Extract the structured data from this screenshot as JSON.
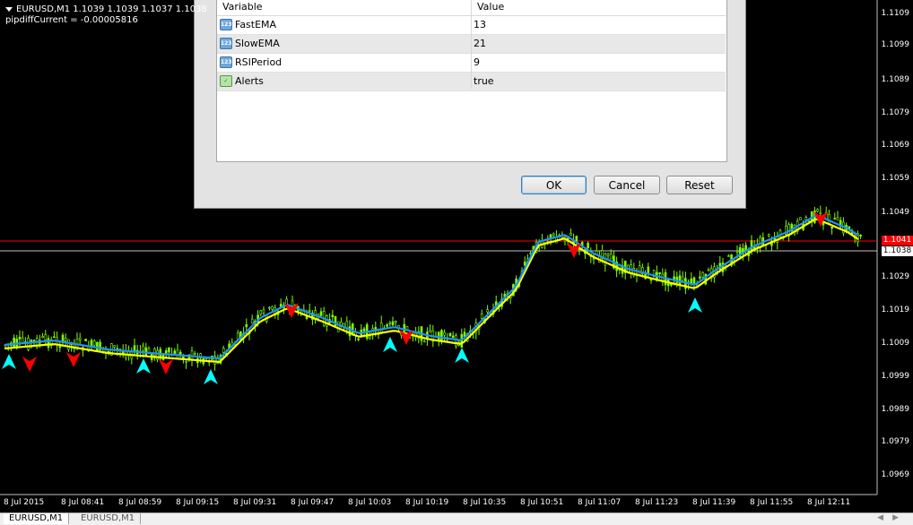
{
  "chart": {
    "symbol_line": "EURUSD,M1  1.1039 1.1039 1.1037 1.1038",
    "indicator_line": "pipdiffCurrent = -0.00005816",
    "price_ticks": [
      "1.1109",
      "1.1099",
      "1.1089",
      "1.1079",
      "1.1069",
      "1.1059",
      "1.1049",
      "1.1029",
      "1.1019",
      "1.1009",
      "1.0999",
      "1.0989",
      "1.0979",
      "1.0969"
    ],
    "time_ticks": [
      "8 Jul 2015",
      "8 Jul 08:41",
      "8 Jul 08:59",
      "8 Jul 09:15",
      "8 Jul 09:31",
      "8 Jul 09:47",
      "8 Jul 10:03",
      "8 Jul 10:19",
      "8 Jul 10:35",
      "8 Jul 10:51",
      "8 Jul 11:07",
      "8 Jul 11:23",
      "8 Jul 11:39",
      "8 Jul 11:55",
      "8 Jul 12:11"
    ],
    "top_price_tag": "1.1041",
    "current_price_tag": "1.1038",
    "colors": {
      "background": "#000000",
      "candles": "#7fff00",
      "fast_ema": "#1e90ff",
      "slow_ema": "#ffff00",
      "buy_arrow": "#00ffff",
      "sell_arrow": "#ff0000",
      "red_line": "#ff0000",
      "bid_line": "#c0c0c0"
    }
  },
  "dialog": {
    "columns": {
      "variable": "Variable",
      "value": "Value"
    },
    "rows": [
      {
        "icon": "123-icon",
        "variable": "FastEMA",
        "value": "13"
      },
      {
        "icon": "123-icon",
        "variable": "SlowEMA",
        "value": "21"
      },
      {
        "icon": "123-icon",
        "variable": "RSIPeriod",
        "value": "9"
      },
      {
        "icon": "bool-icon",
        "variable": "Alerts",
        "value": "true"
      }
    ],
    "buttons": {
      "ok": "OK",
      "cancel": "Cancel",
      "reset": "Reset"
    }
  },
  "tabs": [
    {
      "label": "EURUSD,M1",
      "active": true
    },
    {
      "label": "EURUSD,M1",
      "active": false
    }
  ]
}
